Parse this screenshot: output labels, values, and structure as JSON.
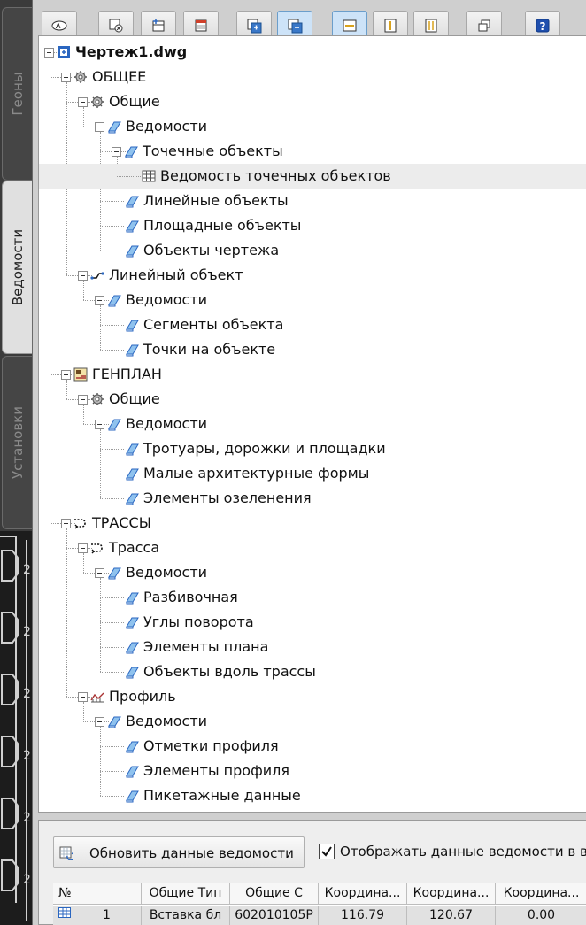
{
  "side_tabs": [
    {
      "label": "Геоны"
    },
    {
      "label": "Ведомости"
    },
    {
      "label": "Установки"
    }
  ],
  "tree": {
    "root": "Чертеж1.dwg",
    "nodes": [
      {
        "label": "ОБЩЕЕ"
      },
      {
        "label": "Общие"
      },
      {
        "label": "Ведомости"
      },
      {
        "label": "Точечные объекты"
      },
      {
        "label": "Ведомость точечных объектов"
      },
      {
        "label": "Линейные объекты"
      },
      {
        "label": "Площадные объекты"
      },
      {
        "label": "Объекты чертежа"
      },
      {
        "label": "Линейный объект"
      },
      {
        "label": "Ведомости"
      },
      {
        "label": "Сегменты объекта"
      },
      {
        "label": "Точки на объекте"
      },
      {
        "label": "ГЕНПЛАН"
      },
      {
        "label": "Общие"
      },
      {
        "label": "Ведомости"
      },
      {
        "label": "Тротуары, дорожки и площадки"
      },
      {
        "label": "Малые архитектурные формы"
      },
      {
        "label": "Элементы озеленения"
      },
      {
        "label": "ТРАССЫ"
      },
      {
        "label": "Трасса"
      },
      {
        "label": "Ведомости"
      },
      {
        "label": "Разбивочная"
      },
      {
        "label": "Углы поворота"
      },
      {
        "label": "Элементы плана"
      },
      {
        "label": "Объекты вдоль трассы"
      },
      {
        "label": "Профиль"
      },
      {
        "label": "Ведомости"
      },
      {
        "label": "Отметки профиля"
      },
      {
        "label": "Элементы профиля"
      },
      {
        "label": "Пикетажные данные"
      }
    ]
  },
  "bottom": {
    "refresh_label": "Обновить данные ведомости",
    "checkbox_label": "Отображать данные ведомости в виде",
    "checkbox_checked": true,
    "table": {
      "headers": [
        "№",
        "Общие Тип",
        "Общие С",
        "Координа...",
        "Координа...",
        "Координа..."
      ],
      "rows": [
        [
          "1",
          "Вставка бл",
          "602010105Р",
          "116.79",
          "120.67",
          "0.00"
        ]
      ]
    }
  },
  "colors": {
    "panel": "#cfcfcf",
    "tree_bg": "#ffffff",
    "selected_row": "#ececec",
    "dark_strip": "#1c1c1c",
    "toolbar_active": "#cde3f8"
  }
}
